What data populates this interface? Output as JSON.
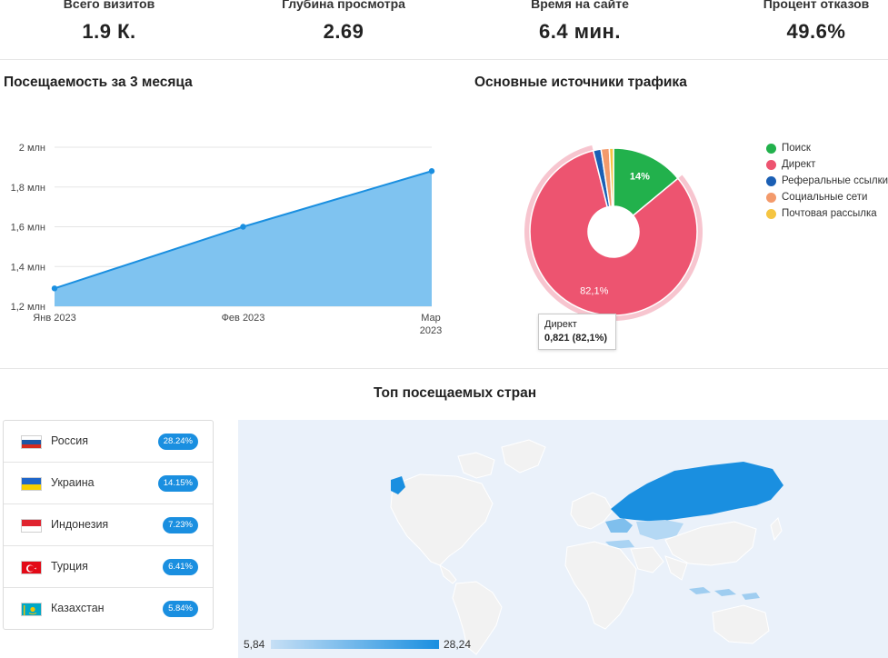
{
  "kpis": [
    {
      "label": "Всего визитов",
      "value": "1.9 К."
    },
    {
      "label": "Глубина просмотра",
      "value": "2.69"
    },
    {
      "label": "Время на сайте",
      "value": "6.4 мин."
    },
    {
      "label": "Процент отказов",
      "value": "49.6%"
    }
  ],
  "attendance": {
    "title": "Посещаемость за 3 месяца"
  },
  "traffic": {
    "title": "Основные источники трафика",
    "tooltip": {
      "name": "Директ",
      "value": "0,821 (82,1%)"
    }
  },
  "countries": {
    "title": "Топ посещаемых стран",
    "items": [
      {
        "name": "Россия",
        "pct": "28.24%",
        "flag": "russia-flag-icon"
      },
      {
        "name": "Украина",
        "pct": "14.15%",
        "flag": "ukraine-flag-icon"
      },
      {
        "name": "Индонезия",
        "pct": "7.23%",
        "flag": "indonesia-flag-icon"
      },
      {
        "name": "Турция",
        "pct": "6.41%",
        "flag": "turkey-flag-icon"
      },
      {
        "name": "Казахстан",
        "pct": "5.84%",
        "flag": "kazakhstan-flag-icon"
      }
    ],
    "scale": {
      "min": "5,84",
      "max": "28,24"
    }
  },
  "colors": {
    "accent": "#1a8fe0",
    "area_fill": "#7fc3f0",
    "line": "#1a8fe0"
  },
  "chart_data": [
    {
      "type": "area",
      "x": [
        "Янв 2023",
        "Фев 2023",
        "Мар 2023"
      ],
      "x_tick_labels": [
        "Янв 2023",
        "Фев 2023",
        "Мар\n2023"
      ],
      "series": [
        {
          "values": [
            1.29,
            1.6,
            1.88
          ]
        }
      ],
      "y_ticks": [
        "1,2 млн",
        "1,4 млн",
        "1,6 млн",
        "1,8 млн",
        "2 млн"
      ],
      "ylim": [
        1.2,
        2.0
      ],
      "grid": true,
      "title": "Посещаемость за 3 месяца"
    },
    {
      "type": "pie",
      "donut": true,
      "labels": [
        "Поиск",
        "Директ",
        "Реферальные ссылки",
        "Социальные сети",
        "Почтовая рассылка"
      ],
      "values": [
        0.14,
        0.821,
        0.015,
        0.016,
        0.008
      ],
      "data_labels": [
        "14%",
        "82,1%",
        "",
        "",
        ""
      ],
      "colors": [
        "#22b14c",
        "#ed5470",
        "#1b5fb4",
        "#f39a6b",
        "#f5c542"
      ],
      "legend": "right",
      "title": "Основные источники трафика"
    }
  ]
}
